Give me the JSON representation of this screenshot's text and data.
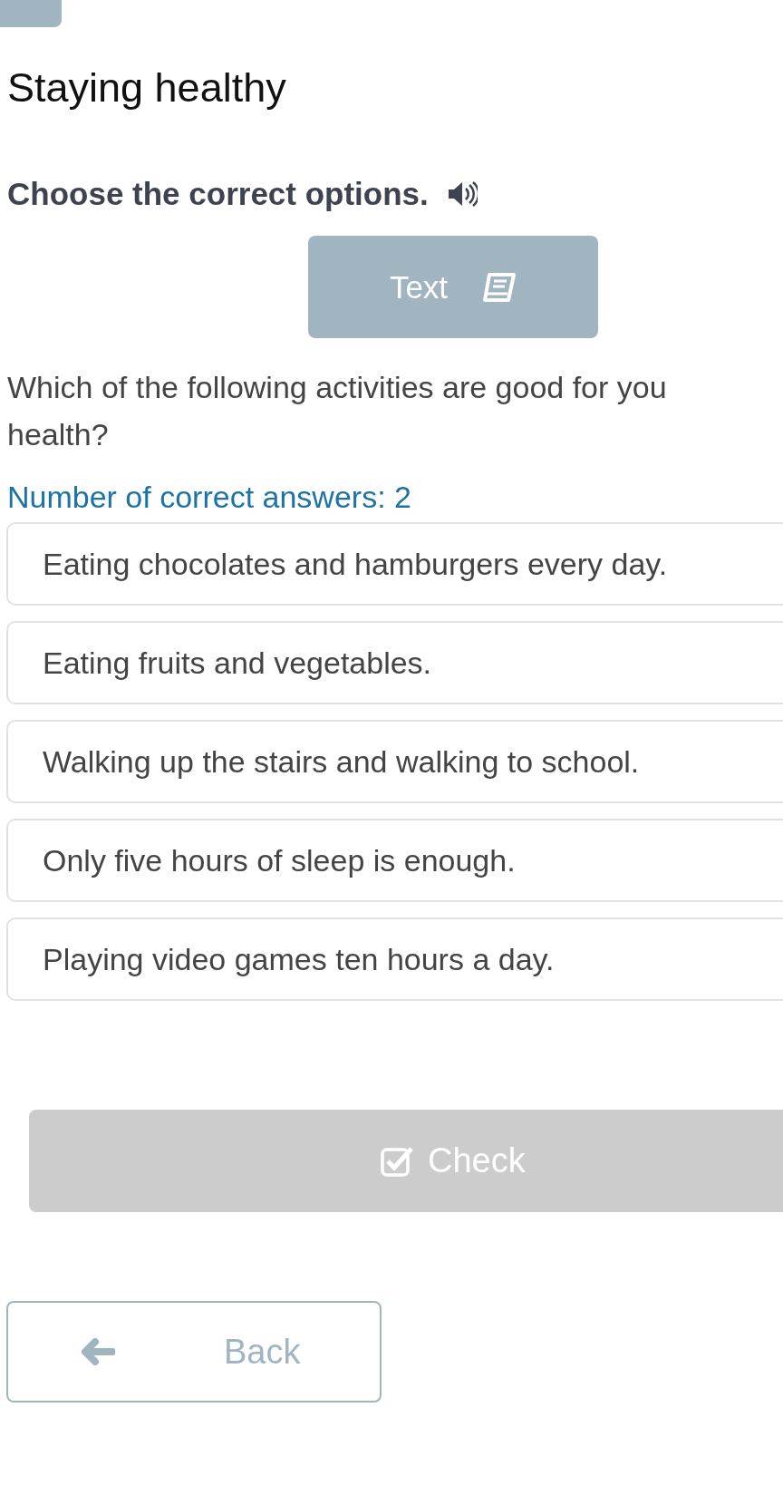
{
  "title": "Staying healthy",
  "instruction": "Choose the correct options.",
  "text_button": "Text",
  "question_lines": [
    "Which of the following activities are good for you",
    "health?"
  ],
  "answer_count": "Number of correct answers: 2",
  "options": [
    {
      "label": "Eating chocolates and hamburgers every day.",
      "selected": false
    },
    {
      "label": "Eating fruits and vegetables.",
      "selected": false
    },
    {
      "label": "Walking up the stairs and walking to school.",
      "selected": false
    },
    {
      "label": "Only five hours of sleep is enough.",
      "selected": false
    },
    {
      "label": "Playing video games ten hours a day.",
      "selected": false
    }
  ],
  "check_button": {
    "label": "Check",
    "disabled": true
  },
  "back_button": "Back"
}
